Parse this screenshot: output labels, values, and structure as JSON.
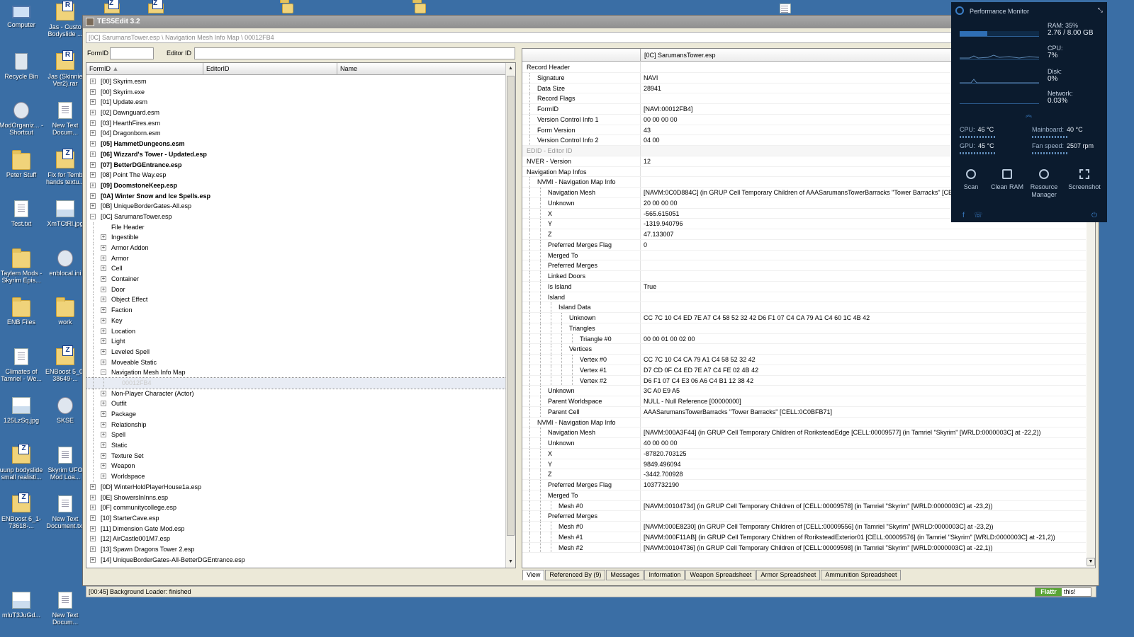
{
  "desktop": {
    "icons_col1": [
      {
        "label": "Computer",
        "kind": "comp"
      },
      {
        "label": "Recycle Bin",
        "kind": "bin"
      },
      {
        "label": "ModOrganiz... - Shortcut",
        "kind": "gear"
      },
      {
        "label": "Peter Stuff",
        "kind": "folder"
      },
      {
        "label": "Test.txt",
        "kind": "doc"
      },
      {
        "label": "Taylem Mods - Skyrim Epis...",
        "kind": "folder"
      },
      {
        "label": "ENB Files",
        "kind": "folder"
      },
      {
        "label": "Climates of Tamriel - We...",
        "kind": "doc"
      },
      {
        "label": "125LzSq.jpg",
        "kind": "img"
      },
      {
        "label": "uunp bodyslide small realisti...",
        "kind": "archive",
        "letter": "Z"
      },
      {
        "label": "ENBoost 6_1-73618-...",
        "kind": "archive",
        "letter": "Z"
      },
      {
        "label": "mluT3JuGd...",
        "kind": "img"
      }
    ],
    "icons_col2": [
      {
        "label": "Jas - Custo Bodyslide ...",
        "kind": "archive",
        "letter": "R"
      },
      {
        "label": "Jas (Skinnie Ver2).rar",
        "kind": "archive",
        "letter": "R"
      },
      {
        "label": "New Text Docum...",
        "kind": "doc"
      },
      {
        "label": "Fix for Temb hands textu...",
        "kind": "archive",
        "letter": "Z"
      },
      {
        "label": "XmTCtRl.jpg",
        "kind": "img"
      },
      {
        "label": "enblocal.ini",
        "kind": "gear"
      },
      {
        "label": "work",
        "kind": "folder"
      },
      {
        "label": "ENBoost 5_0-38649-...",
        "kind": "archive",
        "letter": "Z"
      },
      {
        "label": "SKSE",
        "kind": "gear"
      },
      {
        "label": "Skyrim UFO Mod Loa...",
        "kind": "doc"
      },
      {
        "label": "New Text Document.txt",
        "kind": "doc"
      },
      {
        "label": "New Text Docum...",
        "kind": "doc"
      }
    ]
  },
  "window": {
    "title": "TES5Edit 3.2",
    "path": "[0C] SarumansTower.esp \\ Navigation Mesh Info Map \\ 00012FB4",
    "formid_label": "FormID",
    "editorid_label": "Editor ID",
    "formid_value": "",
    "editorid_value": "",
    "status": "[00:45] Background Loader: finished",
    "flattr": "Flattr",
    "flattr_this": "this!"
  },
  "left_columns": [
    "FormID",
    "EditorID",
    "Name"
  ],
  "tree": [
    {
      "label": "[00] Skyrim.esm",
      "indent": 0,
      "exp": "+"
    },
    {
      "label": "[00] Skyrim.exe",
      "indent": 0,
      "exp": "+"
    },
    {
      "label": "[01] Update.esm",
      "indent": 0,
      "exp": "+"
    },
    {
      "label": "[02] Dawnguard.esm",
      "indent": 0,
      "exp": "+"
    },
    {
      "label": "[03] HearthFires.esm",
      "indent": 0,
      "exp": "+"
    },
    {
      "label": "[04] Dragonborn.esm",
      "indent": 0,
      "exp": "+"
    },
    {
      "label": "[05] HammetDungeons.esm",
      "indent": 0,
      "exp": "+",
      "bold": true
    },
    {
      "label": "[06] Wizzard's Tower - Updated.esp",
      "indent": 0,
      "exp": "+",
      "bold": true
    },
    {
      "label": "[07] BetterDGEntrance.esp",
      "indent": 0,
      "exp": "+",
      "bold": true
    },
    {
      "label": "[08] Point The Way.esp",
      "indent": 0,
      "exp": "+"
    },
    {
      "label": "[09] DoomstoneKeep.esp",
      "indent": 0,
      "exp": "+",
      "bold": true
    },
    {
      "label": "[0A] Winter Snow and Ice Spells.esp",
      "indent": 0,
      "exp": "+",
      "bold": true
    },
    {
      "label": "[0B] UniqueBorderGates-All.esp",
      "indent": 0,
      "exp": "+"
    },
    {
      "label": "[0C] SarumansTower.esp",
      "indent": 0,
      "exp": "-"
    },
    {
      "label": "File Header",
      "indent": 1,
      "exp": ""
    },
    {
      "label": "Ingestible",
      "indent": 1,
      "exp": "+"
    },
    {
      "label": "Armor Addon",
      "indent": 1,
      "exp": "+"
    },
    {
      "label": "Armor",
      "indent": 1,
      "exp": "+"
    },
    {
      "label": "Cell",
      "indent": 1,
      "exp": "+"
    },
    {
      "label": "Container",
      "indent": 1,
      "exp": "+"
    },
    {
      "label": "Door",
      "indent": 1,
      "exp": "+"
    },
    {
      "label": "Object Effect",
      "indent": 1,
      "exp": "+"
    },
    {
      "label": "Faction",
      "indent": 1,
      "exp": "+"
    },
    {
      "label": "Key",
      "indent": 1,
      "exp": "+"
    },
    {
      "label": "Location",
      "indent": 1,
      "exp": "+"
    },
    {
      "label": "Light",
      "indent": 1,
      "exp": "+"
    },
    {
      "label": "Leveled Spell",
      "indent": 1,
      "exp": "+"
    },
    {
      "label": "Moveable Static",
      "indent": 1,
      "exp": "+"
    },
    {
      "label": "Navigation Mesh Info Map",
      "indent": 1,
      "exp": "-"
    },
    {
      "label": "00012FB4",
      "indent": 2,
      "exp": "",
      "selected": true
    },
    {
      "label": "Non-Player Character (Actor)",
      "indent": 1,
      "exp": "+"
    },
    {
      "label": "Outfit",
      "indent": 1,
      "exp": "+"
    },
    {
      "label": "Package",
      "indent": 1,
      "exp": "+"
    },
    {
      "label": "Relationship",
      "indent": 1,
      "exp": "+"
    },
    {
      "label": "Spell",
      "indent": 1,
      "exp": "+"
    },
    {
      "label": "Static",
      "indent": 1,
      "exp": "+"
    },
    {
      "label": "Texture Set",
      "indent": 1,
      "exp": "+"
    },
    {
      "label": "Weapon",
      "indent": 1,
      "exp": "+"
    },
    {
      "label": "Worldspace",
      "indent": 1,
      "exp": "+"
    },
    {
      "label": "[0D] WinterHoldPlayerHouse1a.esp",
      "indent": 0,
      "exp": "+"
    },
    {
      "label": "[0E] ShowersInInns.esp",
      "indent": 0,
      "exp": "+"
    },
    {
      "label": "[0F] communitycollege.esp",
      "indent": 0,
      "exp": "+"
    },
    {
      "label": "[10] StarterCave.esp",
      "indent": 0,
      "exp": "+"
    },
    {
      "label": "[11] Dimension Gate Mod.esp",
      "indent": 0,
      "exp": "+"
    },
    {
      "label": "[12] AirCastle001M7.esp",
      "indent": 0,
      "exp": "+"
    },
    {
      "label": "[13] Spawn Dragons Tower 2.esp",
      "indent": 0,
      "exp": "+"
    },
    {
      "label": "[14] UniqueBorderGates-All-BetterDGEntrance.esp",
      "indent": 0,
      "exp": "+"
    }
  ],
  "record_header": "[0C] SarumansTower.esp",
  "record": [
    {
      "k": "Record Header",
      "v": "",
      "d": 0
    },
    {
      "k": "Signature",
      "v": "NAVI",
      "d": 1
    },
    {
      "k": "Data Size",
      "v": "28941",
      "d": 1
    },
    {
      "k": "Record Flags",
      "v": "",
      "d": 1
    },
    {
      "k": "FormID",
      "v": "[NAVI:00012FB4]",
      "d": 1
    },
    {
      "k": "Version Control Info 1",
      "v": "00 00 00 00",
      "d": 1
    },
    {
      "k": "Form Version",
      "v": "43",
      "d": 1
    },
    {
      "k": "Version Control Info 2",
      "v": "04 00",
      "d": 1
    },
    {
      "k": "EDID - Editor ID",
      "v": "",
      "d": 0,
      "gray": true
    },
    {
      "k": "NVER - Version",
      "v": "12",
      "d": 0
    },
    {
      "k": "Navigation Map Infos",
      "v": "",
      "d": 0
    },
    {
      "k": "NVMI - Navigation Map Info",
      "v": "",
      "d": 1
    },
    {
      "k": "Navigation Mesh",
      "v": "[NAVM:0C0D884C] (in GRUP Cell Temporary Children of AAASarumansTowerBarracks \"Tower Barracks\" [CELL:0",
      "d": 2
    },
    {
      "k": "Unknown",
      "v": "20 00 00 00",
      "d": 2
    },
    {
      "k": "X",
      "v": "-565.615051",
      "d": 2
    },
    {
      "k": "Y",
      "v": "-1319.940796",
      "d": 2
    },
    {
      "k": "Z",
      "v": "47.133007",
      "d": 2
    },
    {
      "k": "Preferred Merges Flag",
      "v": "0",
      "d": 2
    },
    {
      "k": "Merged To",
      "v": "",
      "d": 2
    },
    {
      "k": "Preferred Merges",
      "v": "",
      "d": 2
    },
    {
      "k": "Linked Doors",
      "v": "",
      "d": 2
    },
    {
      "k": "Is Island",
      "v": "True",
      "d": 2
    },
    {
      "k": "Island",
      "v": "",
      "d": 2
    },
    {
      "k": "Island Data",
      "v": "",
      "d": 3
    },
    {
      "k": "Unknown",
      "v": "CC 7C 10 C4 ED 7E A7 C4 58 52 32 42 D6 F1 07 C4 CA 79 A1 C4 60 1C 4B 42",
      "d": 4
    },
    {
      "k": "Triangles",
      "v": "",
      "d": 4
    },
    {
      "k": "Triangle #0",
      "v": "00 00 01 00 02 00",
      "d": 5
    },
    {
      "k": "Vertices",
      "v": "",
      "d": 4
    },
    {
      "k": "Vertex #0",
      "v": "CC 7C 10 C4 CA 79 A1 C4 58 52 32 42",
      "d": 5
    },
    {
      "k": "Vertex #1",
      "v": "D7 CD 0F C4 ED 7E A7 C4 FE 02 4B 42",
      "d": 5
    },
    {
      "k": "Vertex #2",
      "v": "D6 F1 07 C4 E3 06 A6 C4 B1 12 38 42",
      "d": 5
    },
    {
      "k": "Unknown",
      "v": "3C A0 E9 A5",
      "d": 2
    },
    {
      "k": "Parent Worldspace",
      "v": "NULL - Null Reference [00000000]",
      "d": 2
    },
    {
      "k": "Parent Cell",
      "v": "AAASarumansTowerBarracks \"Tower Barracks\" [CELL:0C0BFB71]",
      "d": 2
    },
    {
      "k": "NVMI - Navigation Map Info",
      "v": "",
      "d": 1
    },
    {
      "k": "Navigation Mesh",
      "v": "[NAVM:000A3F44] (in GRUP Cell Temporary Children of RoriksteadEdge [CELL:00009577] (in Tamriel \"Skyrim\" [WRLD:0000003C] at -22,2))",
      "d": 2
    },
    {
      "k": "Unknown",
      "v": "40 00 00 00",
      "d": 2
    },
    {
      "k": "X",
      "v": "-87820.703125",
      "d": 2
    },
    {
      "k": "Y",
      "v": "9849.496094",
      "d": 2
    },
    {
      "k": "Z",
      "v": "-3442.700928",
      "d": 2
    },
    {
      "k": "Preferred Merges Flag",
      "v": "1037732190",
      "d": 2
    },
    {
      "k": "Merged To",
      "v": "",
      "d": 2
    },
    {
      "k": "Mesh #0",
      "v": "[NAVM:00104734] (in GRUP Cell Temporary Children of [CELL:00009578] (in Tamriel \"Skyrim\" [WRLD:0000003C] at -23,2))",
      "d": 3
    },
    {
      "k": "Preferred Merges",
      "v": "",
      "d": 2
    },
    {
      "k": "Mesh #0",
      "v": "[NAVM:000E8230] (in GRUP Cell Temporary Children of [CELL:00009556] (in Tamriel \"Skyrim\" [WRLD:0000003C] at -23,2))",
      "d": 3
    },
    {
      "k": "Mesh #1",
      "v": "[NAVM:000F11AB] (in GRUP Cell Temporary Children of RoriksteadExterior01 [CELL:00009576] (in Tamriel \"Skyrim\" [WRLD:0000003C] at -21,2))",
      "d": 3
    },
    {
      "k": "Mesh #2",
      "v": "[NAVM:00104736] (in GRUP Cell Temporary Children of [CELL:00009598] (in Tamriel \"Skyrim\" [WRLD:0000003C] at -22,1))",
      "d": 3
    }
  ],
  "tabs": [
    "View",
    "Referenced By (9)",
    "Messages",
    "Information",
    "Weapon Spreadsheet",
    "Armor Spreadsheet",
    "Ammunition Spreadsheet"
  ],
  "perf": {
    "title": "Performance Monitor",
    "ram_label": "RAM: 35%",
    "ram_value": "2.76 / 8.00 GB",
    "ram_fraction": 0.35,
    "cpu_label": "CPU:",
    "cpu_value": "7%",
    "disk_label": "Disk:",
    "disk_value": "0%",
    "net_label": "Network:",
    "net_value": "0.03%",
    "cpu_temp_label": "CPU:",
    "cpu_temp": "46 °C",
    "gpu_temp_label": "GPU:",
    "gpu_temp": "45 °C",
    "mb_label": "Mainboard:",
    "mb_temp": "40 °C",
    "fan_label": "Fan speed:",
    "fan_value": "2507 rpm",
    "buttons": [
      "Scan",
      "Clean RAM",
      "Resource Manager",
      "Screenshot"
    ]
  }
}
